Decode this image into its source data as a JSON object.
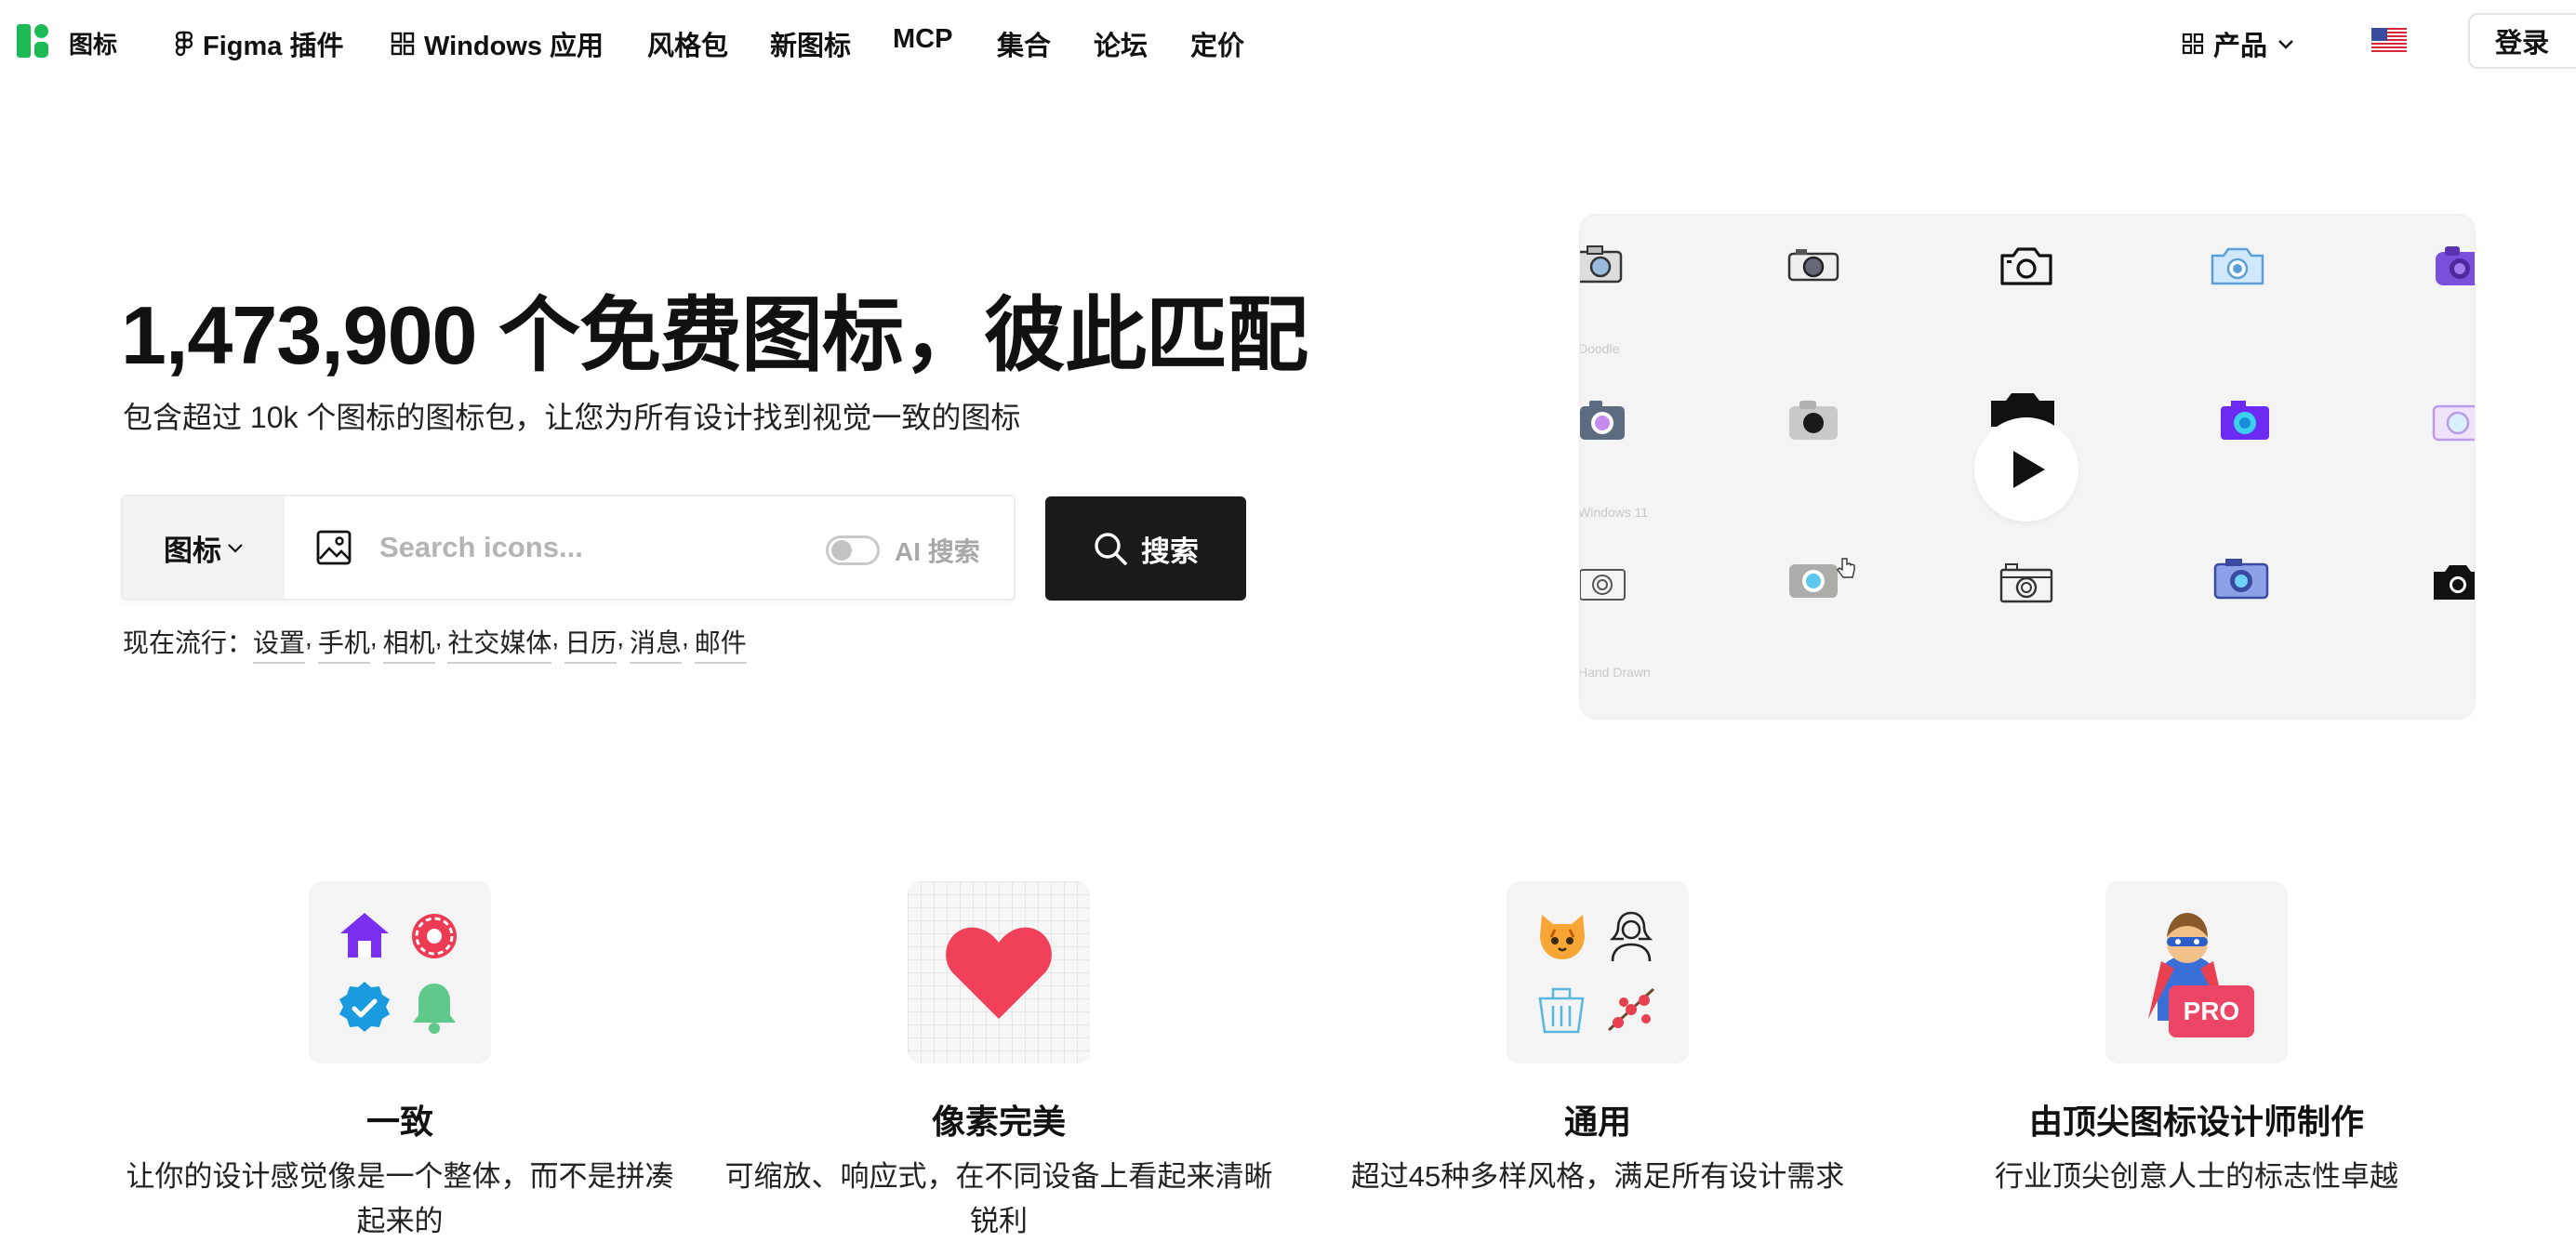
{
  "nav": {
    "brand": "图标",
    "items": [
      {
        "label": "Figma 插件",
        "icon": "figma-icon"
      },
      {
        "label": "Windows 应用",
        "icon": "grid-icon"
      },
      {
        "label": "风格包"
      },
      {
        "label": "新图标"
      },
      {
        "label": "MCP"
      },
      {
        "label": "集合"
      },
      {
        "label": "论坛"
      },
      {
        "label": "定价"
      }
    ],
    "product": "产品",
    "language_flag": "us-flag-icon",
    "login": "登录"
  },
  "hero": {
    "title": "1,473,900 个免费图标，彼此匹配",
    "subtitle": "包含超过 10k 个图标的图标包，让您为所有设计找到视觉一致的图标"
  },
  "search": {
    "type": "图标",
    "placeholder": "Search icons...",
    "ai_label": "AI 搜索",
    "button": "搜索"
  },
  "trending": {
    "prefix": "现在流行：",
    "items": [
      "设置",
      "手机",
      "相机",
      "社交媒体",
      "日历",
      "消息",
      "邮件"
    ]
  },
  "preview": {
    "style_labels": [
      "Doodle",
      "Windows 11",
      "Hand Drawn"
    ]
  },
  "features": [
    {
      "title": "一致",
      "desc": "让你的设计感觉像是一个整体，而不是拼凑起来的"
    },
    {
      "title": "像素完美",
      "desc": "可缩放、响应式，在不同设备上看起来清晰锐利"
    },
    {
      "title": "通用",
      "desc": "超过45种多样风格，满足所有设计需求"
    },
    {
      "title": "由顶尖图标设计师制作",
      "desc": "行业顶尖创意人士的标志性卓越",
      "badge": "PRO"
    }
  ],
  "colors": {
    "brand": "#1db954",
    "search_button": "#1a1a1a",
    "heart": "#f0405a",
    "pro_badge": "#ec4565"
  }
}
